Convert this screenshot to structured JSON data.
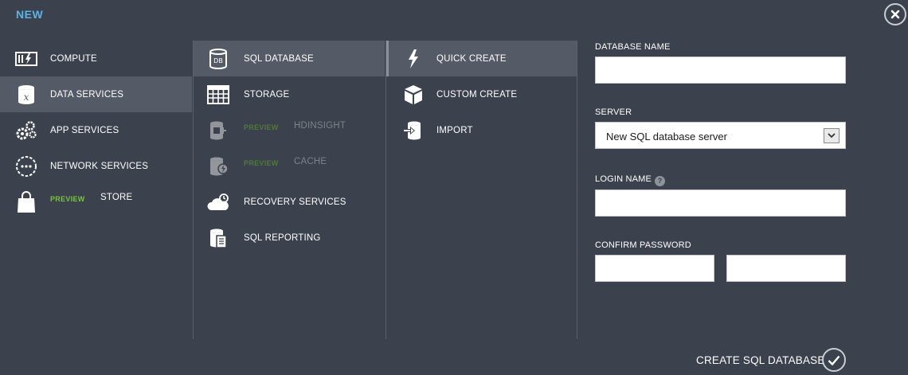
{
  "header": {
    "title": "NEW"
  },
  "categories": [
    {
      "label": "COMPUTE",
      "icon": "compute-icon"
    },
    {
      "label": "DATA SERVICES",
      "icon": "data-services-icon",
      "selected": true
    },
    {
      "label": "APP SERVICES",
      "icon": "gears-icon"
    },
    {
      "label": "NETWORK SERVICES",
      "icon": "network-icon"
    },
    {
      "label": "STORE",
      "sub": "PREVIEW",
      "icon": "shopping-bag-icon"
    }
  ],
  "services": [
    {
      "label": "SQL DATABASE",
      "icon": "database-db-icon",
      "selected": true
    },
    {
      "label": "STORAGE",
      "icon": "storage-table-icon"
    },
    {
      "label": "HDINSIGHT",
      "sub": "PREVIEW",
      "icon": "hdinsight-icon",
      "disabled": true
    },
    {
      "label": "CACHE",
      "sub": "PREVIEW",
      "icon": "cache-icon",
      "disabled": true
    },
    {
      "label": "RECOVERY SERVICES",
      "icon": "cloud-icon"
    },
    {
      "label": "SQL REPORTING",
      "icon": "report-icon"
    }
  ],
  "methods": [
    {
      "label": "QUICK CREATE",
      "icon": "lightning-icon",
      "selected": true
    },
    {
      "label": "CUSTOM CREATE",
      "icon": "box-icon"
    },
    {
      "label": "IMPORT",
      "icon": "import-icon"
    }
  ],
  "form": {
    "database_name_label": "DATABASE NAME",
    "database_name_value": "",
    "server_label": "SERVER",
    "server_value": "New SQL database server",
    "login_label": "LOGIN NAME",
    "login_help": "?",
    "login_value": "",
    "confirm_label": "CONFIRM PASSWORD",
    "password_value": "",
    "confirm_value": ""
  },
  "footer": {
    "create_label": "CREATE SQL DATABASE"
  },
  "colors": {
    "background": "#3b414d",
    "selected": "#555b66",
    "accent_title": "#5ab4e6",
    "preview_green": "#78c243"
  }
}
